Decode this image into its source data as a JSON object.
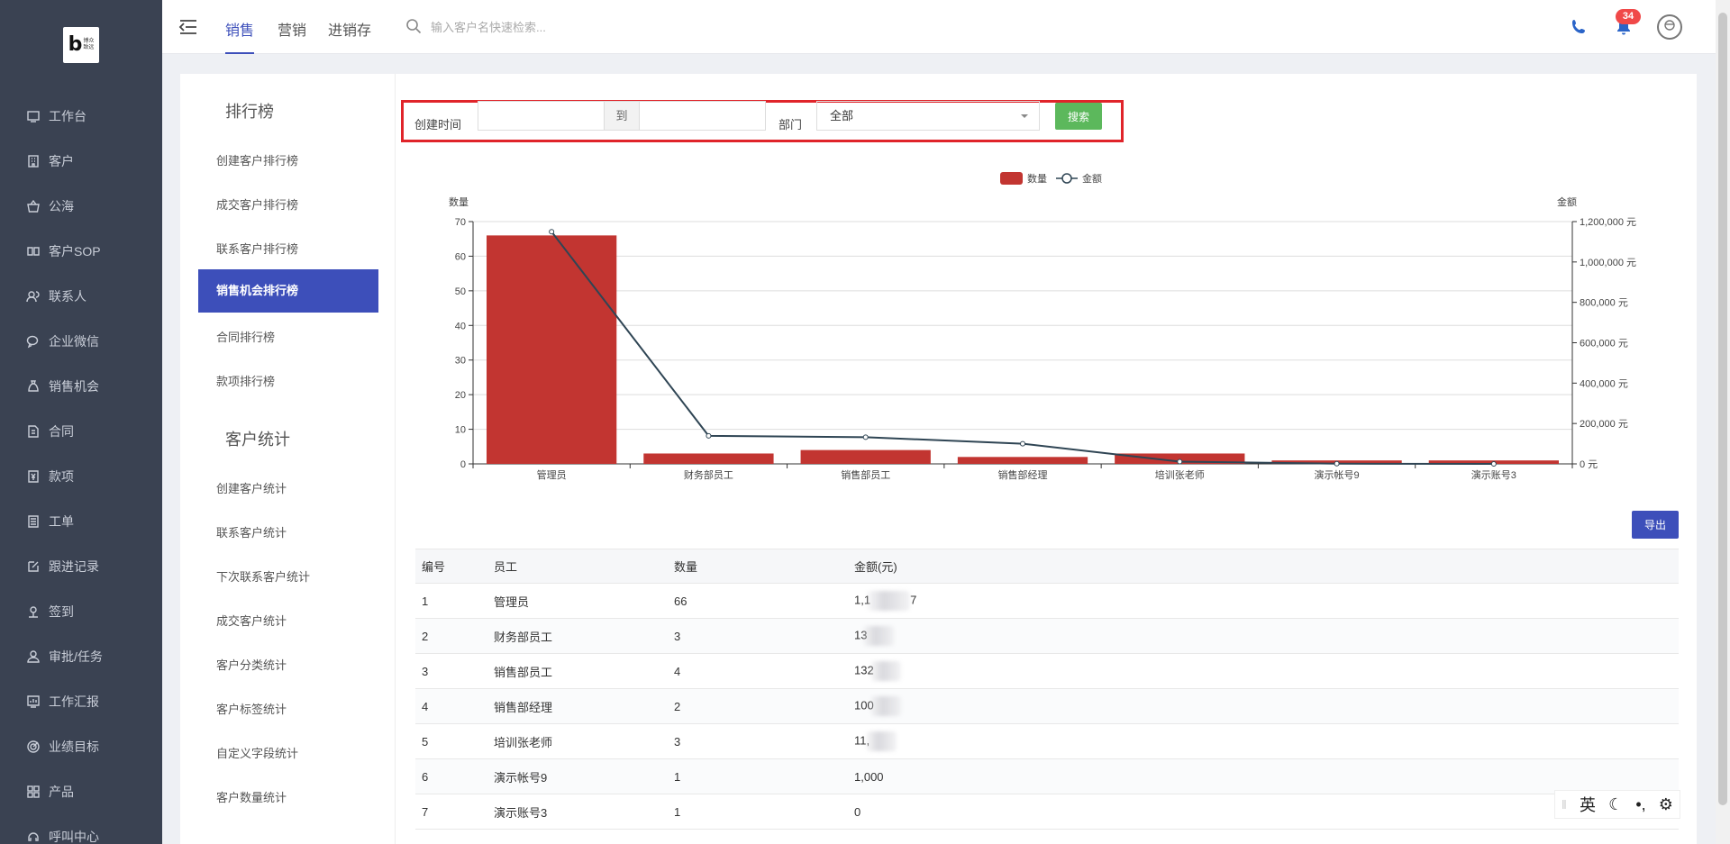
{
  "brand": {
    "logo_letter": "b",
    "logo_text": "博众\n致远"
  },
  "sidebar": {
    "items": [
      {
        "label": "工作台",
        "icon": "monitor-icon"
      },
      {
        "label": "客户",
        "icon": "building-icon"
      },
      {
        "label": "公海",
        "icon": "basket-icon"
      },
      {
        "label": "客户SOP",
        "icon": "sop-icon"
      },
      {
        "label": "联系人",
        "icon": "contacts-icon"
      },
      {
        "label": "企业微信",
        "icon": "wechat-icon"
      },
      {
        "label": "销售机会",
        "icon": "moneybag-icon"
      },
      {
        "label": "合同",
        "icon": "contract-icon"
      },
      {
        "label": "款项",
        "icon": "payment-icon"
      },
      {
        "label": "工单",
        "icon": "ticket-icon"
      },
      {
        "label": "跟进记录",
        "icon": "edit-icon"
      },
      {
        "label": "签到",
        "icon": "checkin-icon"
      },
      {
        "label": "审批/任务",
        "icon": "approval-icon"
      },
      {
        "label": "工作汇报",
        "icon": "report-icon"
      },
      {
        "label": "业绩目标",
        "icon": "target-icon"
      },
      {
        "label": "产品",
        "icon": "grid-icon"
      },
      {
        "label": "呼叫中心",
        "icon": "call-center-icon"
      }
    ]
  },
  "topbar": {
    "tabs": [
      "销售",
      "营销",
      "进销存"
    ],
    "active_tab": "销售",
    "search_placeholder": "输入客户名快速检索...",
    "notification_count": "34"
  },
  "sub_menu": {
    "group1_title": "排行榜",
    "group1_items": [
      "创建客户排行榜",
      "成交客户排行榜",
      "联系客户排行榜",
      "销售机会排行榜",
      "合同排行榜",
      "款项排行榜"
    ],
    "active_item": "销售机会排行榜",
    "group2_title": "客户统计",
    "group2_items": [
      "创建客户统计",
      "联系客户统计",
      "下次联系客户统计",
      "成交客户统计",
      "客户分类统计",
      "客户标签统计",
      "自定义字段统计",
      "客户数量统计"
    ]
  },
  "filter": {
    "created_label": "创建时间",
    "start_value": "",
    "to_label": "到",
    "end_value": "",
    "dept_label": "部门",
    "dept_value": "全部",
    "search_button": "搜索"
  },
  "chart_data": {
    "type": "bar",
    "categories": [
      "管理员",
      "财务部员工",
      "销售部员工",
      "销售部经理",
      "培训张老师",
      "演示帐号9",
      "演示账号3"
    ],
    "series": [
      {
        "name": "数量",
        "type": "bar",
        "axis": "left",
        "values": [
          66,
          3,
          4,
          2,
          3,
          1,
          1
        ],
        "color": "#c23531"
      },
      {
        "name": "金额",
        "type": "line",
        "axis": "right",
        "values": [
          1150000,
          139000,
          132000,
          100000,
          11000,
          1000,
          0
        ],
        "color": "#2f4554"
      }
    ],
    "y_left": {
      "label": "数量",
      "min": 0,
      "max": 70,
      "ticks": [
        0,
        10,
        20,
        30,
        40,
        50,
        60,
        70
      ]
    },
    "y_right": {
      "label": "金额",
      "min": 0,
      "max": 1200000,
      "ticks": [
        "0 元",
        "200,000 元",
        "400,000 元",
        "600,000 元",
        "800,000 元",
        "1,000,000 元",
        "1,200,000 元"
      ]
    },
    "legend_position": "top-center",
    "grid": true
  },
  "table": {
    "export_button": "导出",
    "headers": [
      "编号",
      "员工",
      "数量",
      "金额(元)"
    ],
    "rows": [
      {
        "id": "1",
        "name": "管理员",
        "count": "66",
        "amount_pre": "1,1",
        "amount_post": "7"
      },
      {
        "id": "2",
        "name": "财务部员工",
        "count": "3",
        "amount_pre": "13",
        "amount_post": ""
      },
      {
        "id": "3",
        "name": "销售部员工",
        "count": "4",
        "amount_pre": "132",
        "amount_post": ""
      },
      {
        "id": "4",
        "name": "销售部经理",
        "count": "2",
        "amount_pre": "100",
        "amount_post": ""
      },
      {
        "id": "5",
        "name": "培训张老师",
        "count": "3",
        "amount_pre": "11,",
        "amount_post": ""
      },
      {
        "id": "6",
        "name": "演示帐号9",
        "count": "1",
        "amount_pre": "1,000",
        "amount_post": ""
      },
      {
        "id": "7",
        "name": "演示账号3",
        "count": "1",
        "amount_pre": "0",
        "amount_post": ""
      }
    ]
  },
  "ime_toolbar": {
    "mode": "英"
  }
}
